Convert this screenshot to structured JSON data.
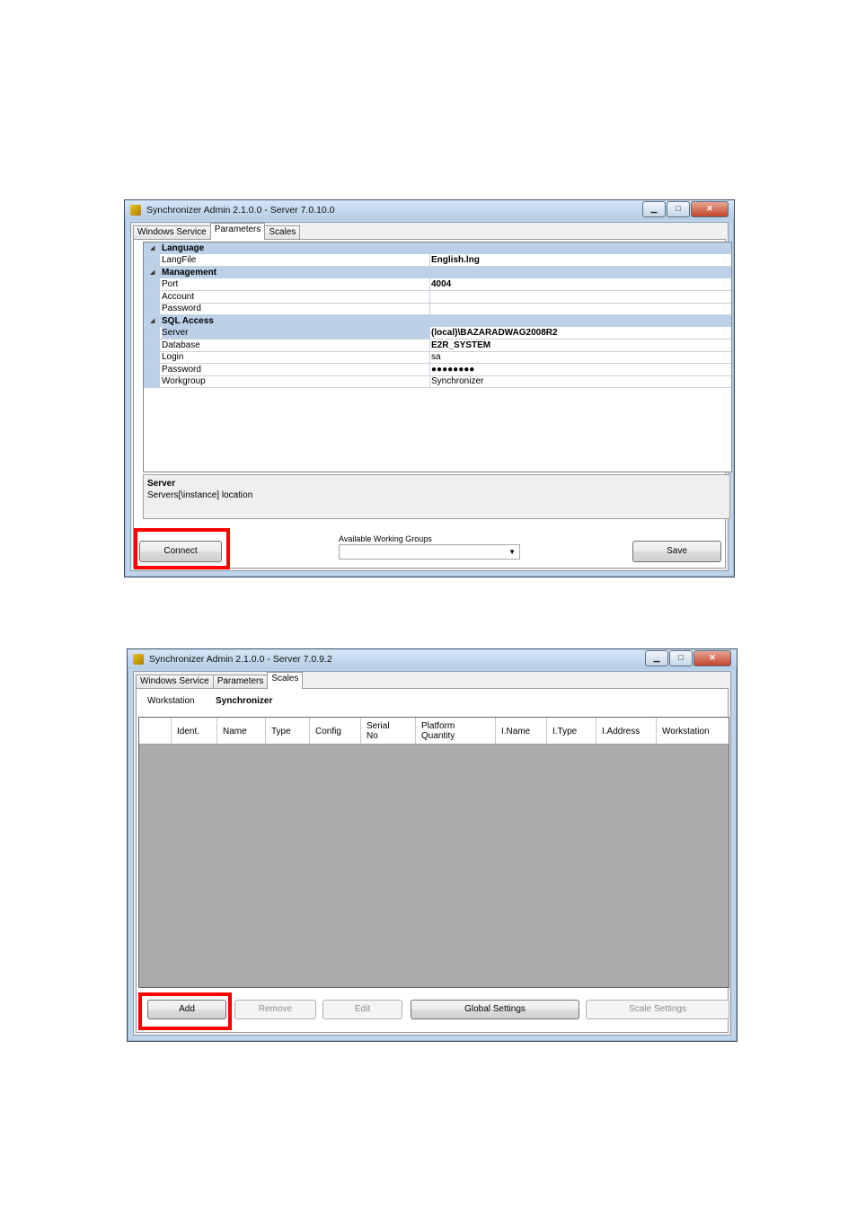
{
  "window1": {
    "title": "Synchronizer Admin 2.1.0.0 - Server 7.0.10.0",
    "tabs": [
      "Windows Service",
      "Parameters",
      "Scales"
    ],
    "active_tab": "Parameters",
    "categories": {
      "language": {
        "label": "Language",
        "rows": [
          {
            "name": "LangFile",
            "value": "English.lng"
          }
        ]
      },
      "management": {
        "label": "Management",
        "rows": [
          {
            "name": "Port",
            "value": "4004"
          },
          {
            "name": "Account",
            "value": ""
          },
          {
            "name": "Password",
            "value": ""
          }
        ]
      },
      "sql": {
        "label": "SQL Access",
        "rows": [
          {
            "name": "Server",
            "value": "(local)\\BAZARADWAG2008R2"
          },
          {
            "name": "Database",
            "value": "E2R_SYSTEM"
          },
          {
            "name": "Login",
            "value": "sa"
          },
          {
            "name": "Password",
            "value": "●●●●●●●●"
          },
          {
            "name": "Workgroup",
            "value": "Synchronizer"
          }
        ]
      }
    },
    "description": {
      "title": "Server",
      "text": "Servers[\\instance] location"
    },
    "connect_label": "Connect",
    "working_groups_label": "Available Working Groups",
    "working_groups_value": "",
    "save_label": "Save"
  },
  "window2": {
    "title": "Synchronizer Admin 2.1.0.0 - Server 7.0.9.2",
    "tabs": [
      "Windows Service",
      "Parameters",
      "Scales"
    ],
    "active_tab": "Scales",
    "workstation_label": "Workstation",
    "workstation_value": "Synchronizer",
    "columns": [
      "Ident.",
      "Name",
      "Type",
      "Config",
      "Serial No",
      "Platform Quantity",
      "I.Name",
      "I.Type",
      "I.Address",
      "Workstation"
    ],
    "buttons": {
      "add": "Add",
      "remove": "Remove",
      "edit": "Edit",
      "global": "Global Settings",
      "scale": "Scale Settings"
    }
  },
  "colors": {
    "highlight": "#ff0000",
    "grid_background": "#ababab",
    "category_band": "#bcd0e7"
  }
}
